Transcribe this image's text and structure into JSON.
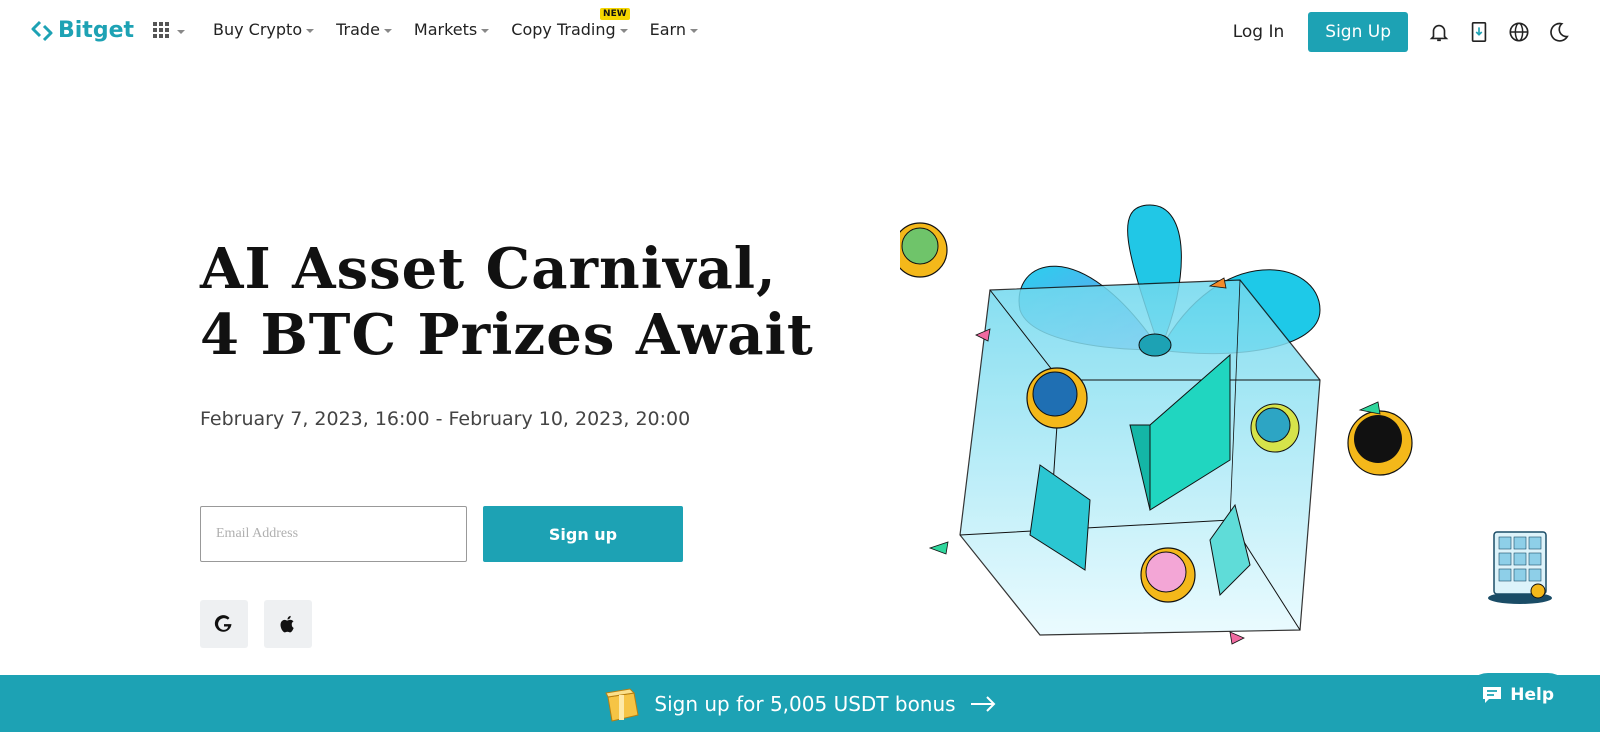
{
  "brand": {
    "name": "Bitget",
    "color": "#1da2b4"
  },
  "nav": {
    "items": [
      {
        "label": "Buy Crypto"
      },
      {
        "label": "Trade"
      },
      {
        "label": "Markets"
      },
      {
        "label": "Copy Trading",
        "badge": "NEW"
      },
      {
        "label": "Earn"
      }
    ],
    "login_label": "Log In",
    "signup_label": "Sign Up",
    "icons": [
      "apps-grid-icon",
      "bell-icon",
      "download-icon",
      "globe-icon",
      "moon-icon"
    ]
  },
  "hero": {
    "title_line1": "AI Asset Carnival,",
    "title_line2": "4 BTC Prizes Await",
    "date_range": "February 7, 2023, 16:00 - February 10, 2023, 20:00",
    "email_placeholder": "Email Address",
    "signup_label": "Sign up",
    "social_icons": [
      "google-icon",
      "apple-icon"
    ]
  },
  "banner": {
    "text": "Sign up for 5,005 USDT bonus"
  },
  "help": {
    "label": "Help"
  }
}
